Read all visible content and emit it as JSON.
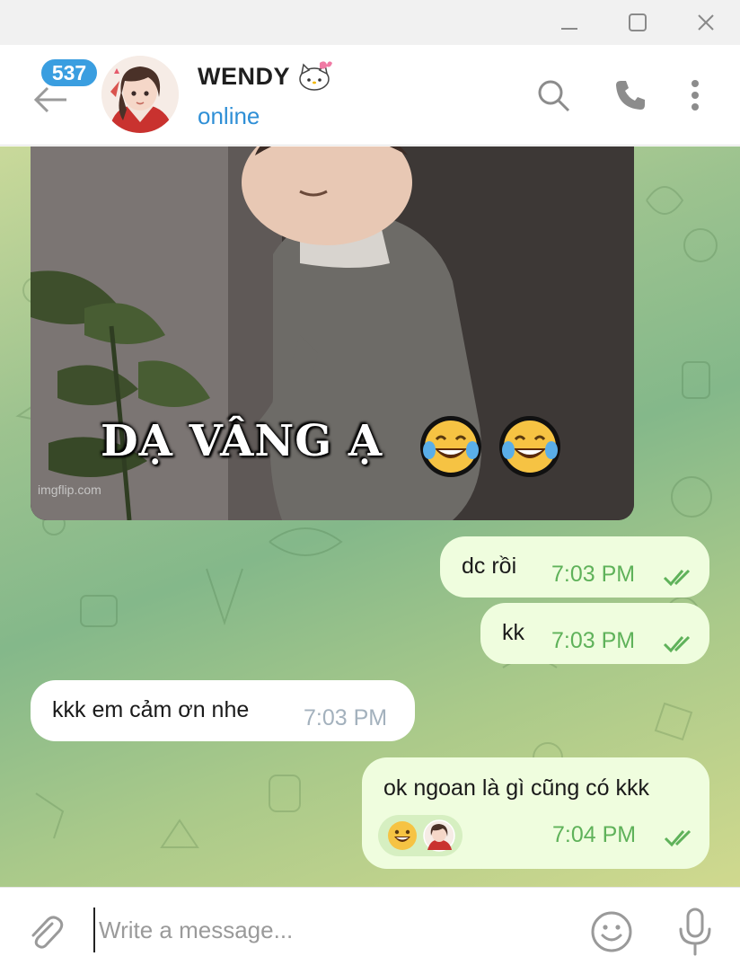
{
  "window": {
    "controls": [
      "minimize",
      "maximize",
      "close"
    ]
  },
  "header": {
    "unread_count": "537",
    "contact_name": "WENDY",
    "contact_status": "online",
    "icons": [
      "back-arrow-icon",
      "search-icon",
      "phone-icon",
      "more-vertical-icon"
    ]
  },
  "gif": {
    "caption": "DẠ VÂNG Ạ",
    "watermark": "imgflip.com",
    "emoji": [
      "face-with-tears-of-joy",
      "face-with-tears-of-joy"
    ]
  },
  "messages": [
    {
      "direction": "outgoing",
      "text": "dc rồi",
      "time": "7:03 PM",
      "status": "read"
    },
    {
      "direction": "outgoing",
      "text": "kk",
      "time": "7:03 PM",
      "status": "read"
    },
    {
      "direction": "incoming",
      "text": "kkk em cảm ơn nhe",
      "time": "7:03 PM"
    },
    {
      "direction": "outgoing",
      "text": "ok ngoan là gì cũng có kkk",
      "time": "7:04 PM",
      "status": "read",
      "reactions": [
        "grinning-face",
        "avatar"
      ]
    }
  ],
  "composer": {
    "placeholder": "Write a message...",
    "value": ""
  },
  "colors": {
    "accent": "#3a9ee0",
    "status_online": "#2f8fd6",
    "outgoing_bubble": "#effdde",
    "incoming_bubble": "#ffffff",
    "outgoing_time": "#5fb25a",
    "incoming_time": "#a3b1bd"
  }
}
